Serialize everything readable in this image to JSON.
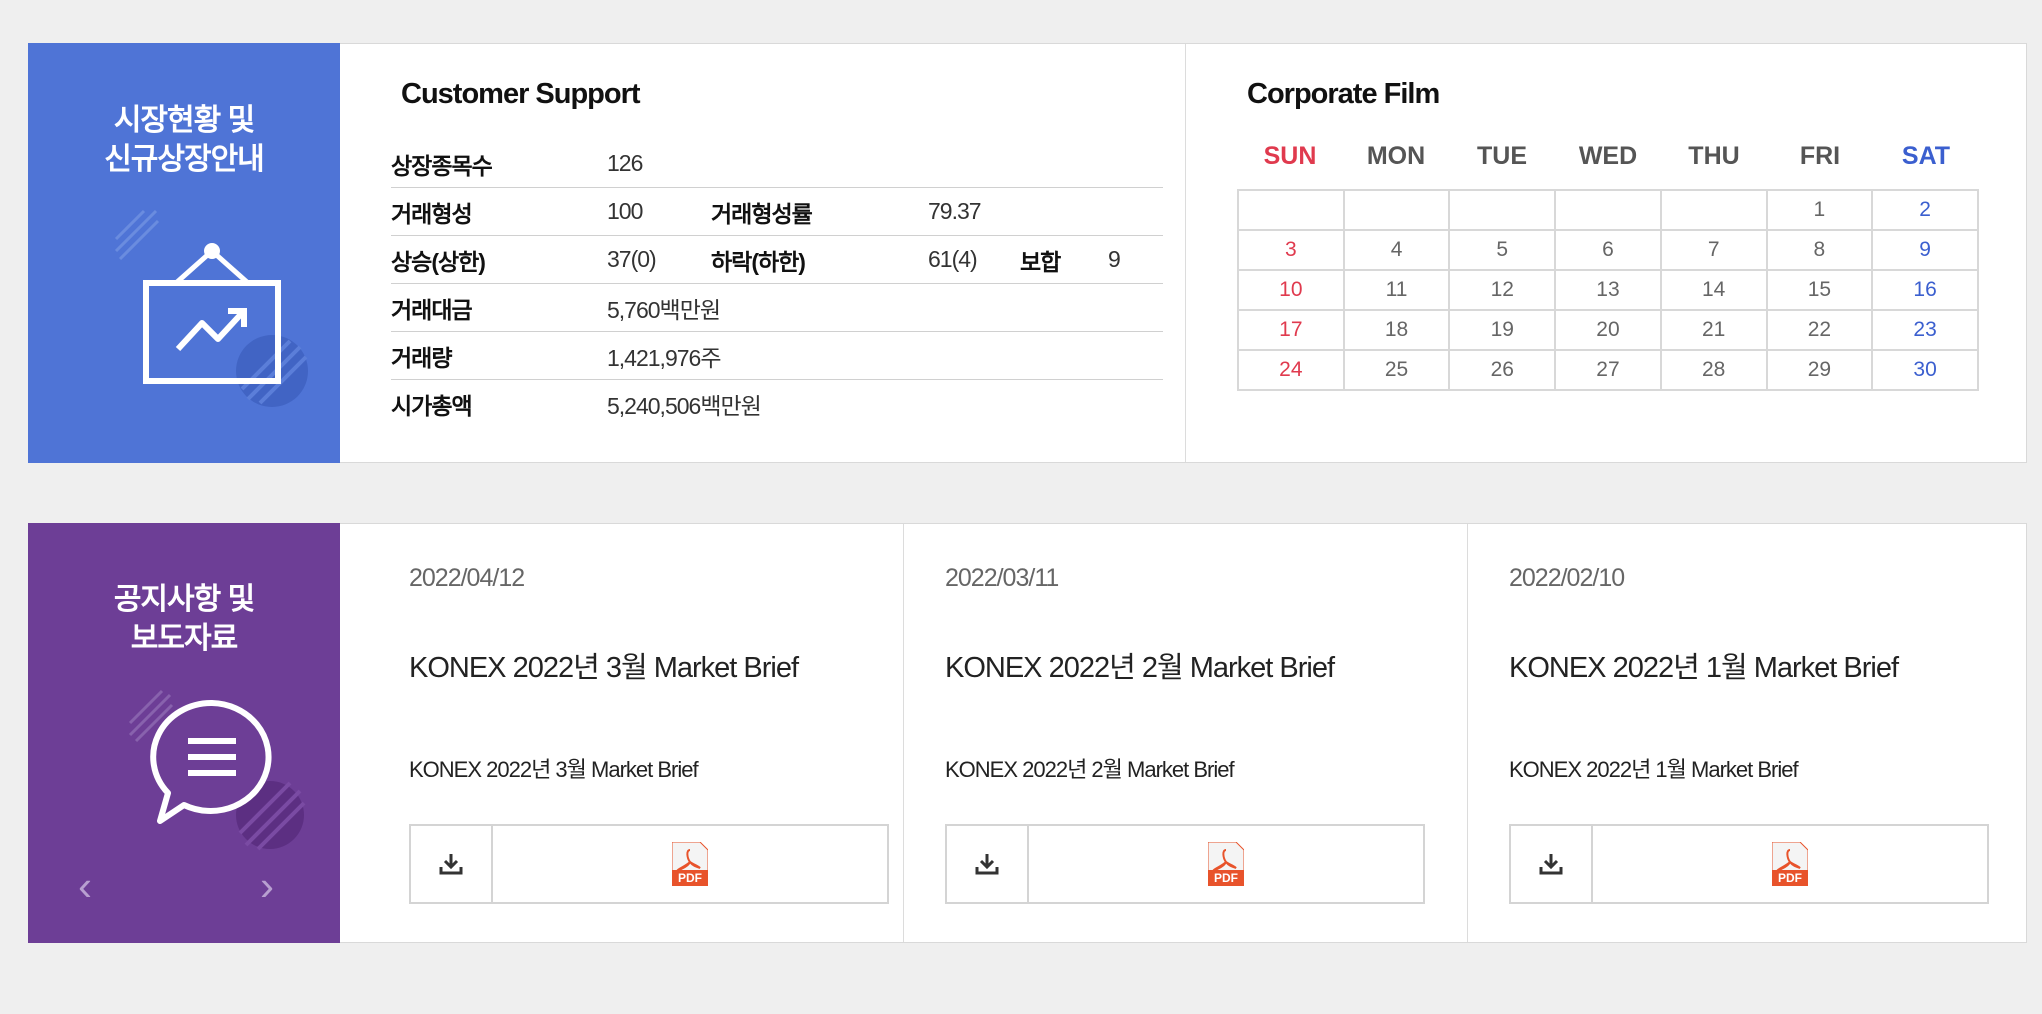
{
  "market": {
    "side_title_line1": "시장현황 및",
    "side_title_line2": "신규상장안내",
    "section_title": "Customer Support",
    "rows": {
      "listed_label": "상장종목수",
      "listed_value": "126",
      "traded_label": "거래형성",
      "traded_value": "100",
      "traded_rate_label": "거래형성률",
      "traded_rate_value": "79.37",
      "up_label": "상승(상한)",
      "up_value": "37(0)",
      "down_label": "하락(하한)",
      "down_value": "61(4)",
      "flat_label": "보합",
      "flat_value": "9",
      "amount_label": "거래대금",
      "amount_value": "5,760백만원",
      "volume_label": "거래량",
      "volume_value": "1,421,976주",
      "cap_label": "시가총액",
      "cap_value": "5,240,506백만원"
    }
  },
  "calendar": {
    "title": "Corporate Film",
    "days": [
      "SUN",
      "MON",
      "TUE",
      "WED",
      "THU",
      "FRI",
      "SAT"
    ],
    "weeks": [
      [
        "",
        "",
        "",
        "",
        "",
        "1",
        "2"
      ],
      [
        "3",
        "4",
        "5",
        "6",
        "7",
        "8",
        "9"
      ],
      [
        "10",
        "11",
        "12",
        "13",
        "14",
        "15",
        "16"
      ],
      [
        "17",
        "18",
        "19",
        "20",
        "21",
        "22",
        "23"
      ],
      [
        "24",
        "25",
        "26",
        "27",
        "28",
        "29",
        "30"
      ]
    ]
  },
  "notice": {
    "side_title_line1": "공지사항 및",
    "side_title_line2": "보도자료",
    "prev_arrow": "‹",
    "next_arrow": "›",
    "cards": [
      {
        "date": "2022/04/12",
        "title": "KONEX 2022년 3월 Market Brief",
        "subtitle": "KONEX 2022년 3월 Market Brief"
      },
      {
        "date": "2022/03/11",
        "title": "KONEX 2022년 2월 Market Brief",
        "subtitle": "KONEX 2022년 2월 Market Brief"
      },
      {
        "date": "2022/02/10",
        "title": "KONEX 2022년 1월 Market Brief",
        "subtitle": "KONEX 2022년 1월 Market Brief"
      }
    ],
    "pdf_badge": "PDF"
  },
  "colors": {
    "market_side": "#4f74d6",
    "notice_side": "#6d3e96",
    "sunday": "#e03a4e",
    "saturday": "#3b5fcf",
    "pdf": "#e8532b"
  },
  "icons": {
    "market": "chart-board-icon",
    "notice": "speech-bubble-menu-icon",
    "download": "download-icon",
    "pdf": "pdf-file-icon"
  }
}
